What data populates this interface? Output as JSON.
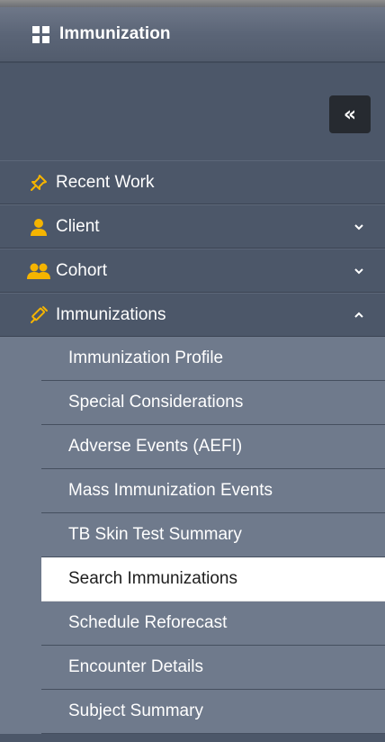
{
  "header": {
    "title": "Immunization",
    "icon": "grid-icon"
  },
  "collapse_button": {
    "label": "«"
  },
  "nav": {
    "recent": {
      "label": "Recent Work",
      "icon": "pin-icon"
    },
    "client": {
      "label": "Client",
      "icon": "person-icon"
    },
    "cohort": {
      "label": "Cohort",
      "icon": "group-icon"
    },
    "immunizations": {
      "label": "Immunizations",
      "icon": "syringe-icon",
      "items": [
        {
          "label": "Immunization Profile"
        },
        {
          "label": "Special Considerations"
        },
        {
          "label": "Adverse Events (AEFI)"
        },
        {
          "label": "Mass Immunization Events"
        },
        {
          "label": "TB Skin Test Summary"
        },
        {
          "label": "Search Immunizations"
        },
        {
          "label": "Schedule Reforecast"
        },
        {
          "label": "Encounter Details"
        },
        {
          "label": "Subject Summary"
        }
      ]
    }
  },
  "colors": {
    "sidebar_bg": "#4c5769",
    "submenu_bg": "#6f7a8c",
    "active_bg": "#ffffff",
    "icon_accent": "#f5b400",
    "collapse_btn_bg": "#262a30"
  }
}
